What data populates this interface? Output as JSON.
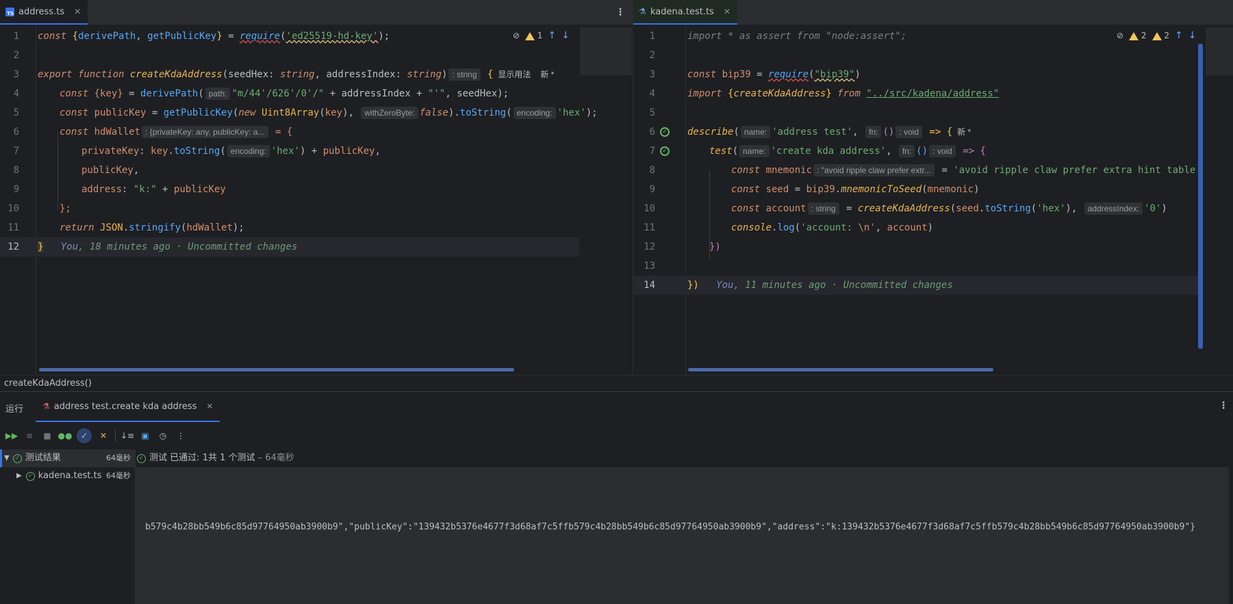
{
  "left_editor": {
    "tab": {
      "label": "address.ts",
      "icon": "typescript-file-icon"
    },
    "inspection": {
      "warnings": "1"
    },
    "current_line": "12",
    "line_numbers": [
      "1",
      "2",
      "3",
      "4",
      "5",
      "6",
      "7",
      "8",
      "9",
      "10",
      "11",
      "12"
    ],
    "code": {
      "l1": {
        "a": "const ",
        "b": "{",
        "c": "derivePath",
        "d": ", ",
        "e": "getPublicKey",
        "f": "}",
        "g": " = ",
        "h": "require",
        "i": "(",
        "j": "'ed25519-hd-key'",
        "k": ");"
      },
      "l3": {
        "a": "export ",
        "b": "function ",
        "c": "createKdaAddress",
        "d": "(seedHex: ",
        "e": "string",
        "f": ", addressIndex: ",
        "g": "string",
        "h": ")",
        "hint": ": string",
        "i": " {",
        "usage": "显示用法",
        "new": "新 *"
      },
      "l4": {
        "a": "const ",
        "b": "{key}",
        "c": " = ",
        "d": "derivePath",
        "e": "(",
        "hint": "path:",
        "f": "\"m/44'/626'/0'/\"",
        "g": " + addressIndex + ",
        "h": "\"'\"",
        "i": ", seedHex);"
      },
      "l5": {
        "a": "const ",
        "b": "publicKey",
        "c": " = ",
        "d": "getPublicKey",
        "e": "(",
        "f": "new ",
        "g": "Uint8Array",
        "h": "(",
        "i": "key",
        "j": "), ",
        "hint": "withZeroByte:",
        "k": "false",
        "l": ").",
        "m": "toString",
        "n": "(",
        "hint2": "encoding:",
        "o": "'hex'",
        "p": ");"
      },
      "l6": {
        "a": "const ",
        "b": "hdWallet",
        "hint": ": {privateKey: any, publicKey: a...",
        "c": " = {"
      },
      "l7": {
        "a": "privateKey",
        "b": ": ",
        "c": "key",
        "d": ".",
        "e": "toString",
        "f": "(",
        "hint": "encoding:",
        "g": "'hex'",
        "h": ") + ",
        "i": "publicKey",
        "j": ","
      },
      "l8": {
        "a": "publicKey",
        "b": ","
      },
      "l9": {
        "a": "address",
        "b": ": ",
        "c": "\"k:\"",
        "d": " + ",
        "e": "publicKey"
      },
      "l10": {
        "a": "};"
      },
      "l11": {
        "a": "return ",
        "b": "JSON",
        "c": ".",
        "d": "stringify",
        "e": "(",
        "f": "hdWallet",
        "g": ");"
      },
      "l12": {
        "a": "}",
        "you": "You",
        "blame": ", 18 minutes ago · Uncommitted changes"
      }
    }
  },
  "right_editor": {
    "tab": {
      "label": "kadena.test.ts",
      "icon": "test-file-icon"
    },
    "inspection": {
      "warnings_a": "2",
      "warnings_b": "2"
    },
    "current_line": "14",
    "line_numbers": [
      "1",
      "2",
      "3",
      "4",
      "5",
      "6",
      "7",
      "8",
      "9",
      "10",
      "11",
      "12",
      "13",
      "14"
    ],
    "code": {
      "l1": {
        "a": "import * as assert from \"node:assert\";"
      },
      "l3": {
        "a": "const ",
        "b": "bip39",
        "c": " = ",
        "d": "require",
        "e": "(",
        "f": "\"bip39\"",
        "g": ")"
      },
      "l4": {
        "a": "import ",
        "b": "{",
        "c": "createKdaAddress",
        "d": "} ",
        "e": "from ",
        "f": "\"../src/kadena/address\""
      },
      "l6": {
        "a": "describe",
        "b": "(",
        "hint": "name:",
        "c": "'address test'",
        "d": ", ",
        "hint2": "fn:",
        "e": "()",
        "hint3": ": void",
        "f": " => {",
        "new": "新 *"
      },
      "l7": {
        "a": "test",
        "b": "(",
        "hint": "name:",
        "c": "'create kda address'",
        "d": ", ",
        "hint2": "fn:",
        "e": "()",
        "hint3": ": void",
        "f": " => {"
      },
      "l8": {
        "a": "const ",
        "b": "mnemonic",
        "hint": ": \"avoid ripple claw prefer extr...",
        "c": " = ",
        "d": "'avoid ripple claw prefer extra hint table"
      },
      "l9": {
        "a": "const ",
        "b": "seed",
        "c": " = ",
        "d": "bip39",
        "e": ".",
        "f": "mnemonicToSeed",
        "g": "(",
        "h": "mnemonic",
        "i": ")"
      },
      "l10": {
        "a": "const ",
        "b": "account",
        "hint": ": string",
        "c": " = ",
        "d": "createKdaAddress",
        "e": "(",
        "f": "seed",
        "g": ".",
        "h": "toString",
        "i": "(",
        "j": "'hex'",
        "k": "), ",
        "hint2": "addressIndex:",
        "l": "'0'",
        "m": ")"
      },
      "l11": {
        "a": "console",
        "b": ".",
        "c": "log",
        "d": "(",
        "e": "'account: ",
        "f": "\\n",
        "g": "'",
        "h": ", ",
        "i": "account",
        "j": ")"
      },
      "l12": {
        "a": "})"
      },
      "l14": {
        "a": "})",
        "you": "You",
        "blame": ", 11 minutes ago · Uncommitted changes"
      }
    }
  },
  "breadcrumb": "createKdaAddress()",
  "run_panel": {
    "title": "运行",
    "tab_label": "address test.create kda address",
    "tree": {
      "root_label": "测试结果",
      "root_duration": "64毫秒",
      "child_label": "kadena.test.ts",
      "child_duration": "64毫秒"
    },
    "status": {
      "prefix": "测试",
      "passed": "已通过:",
      "count": "1共 1 个测试",
      "duration": "– 64毫秒"
    },
    "console_output": "b579c4b28bb549b6c85d97764950ab3900b9\",\"publicKey\":\"139432b5376e4677f3d68af7c5ffb579c4b28bb549b6c85d97764950ab3900b9\",\"address\":\"k:139432b5376e4677f3d68af7c5ffb579c4b28bb549b6c85d97764950ab3900b9\"}"
  },
  "colors": {
    "accent": "#3574f0",
    "success": "#5fb865",
    "warning": "#f2c55c",
    "background": "#1e1f22"
  }
}
